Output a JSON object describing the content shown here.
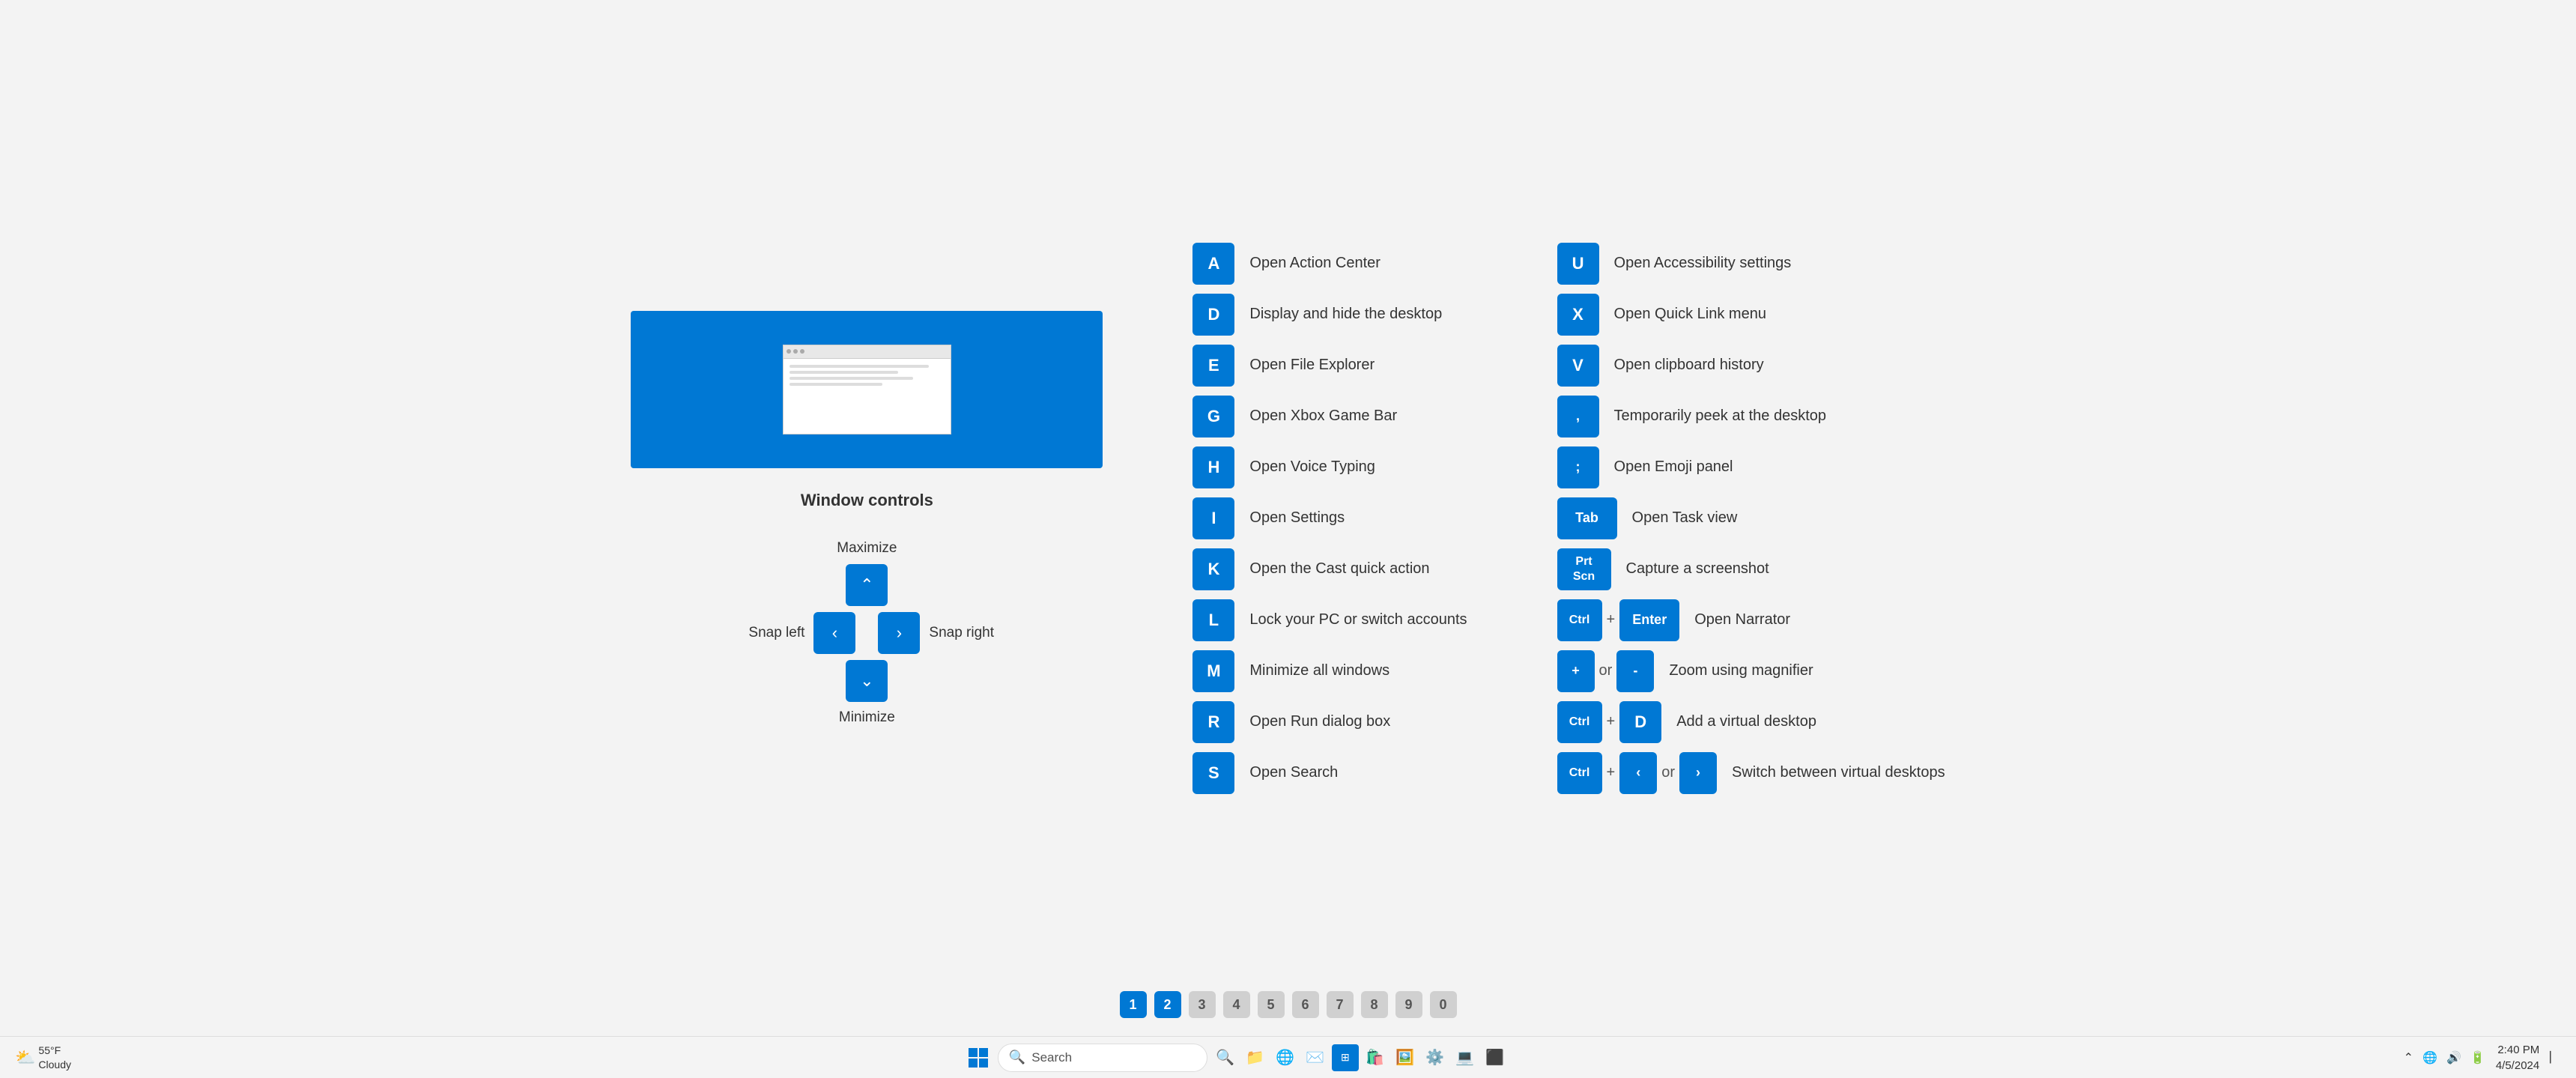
{
  "left_panel": {
    "window_controls_label": "Window controls",
    "controls": {
      "maximize_label": "Maximize",
      "snap_left_label": "Snap left",
      "snap_right_label": "Snap right",
      "minimize_label": "Minimize",
      "up_arrow": "^",
      "left_arrow": "<",
      "right_arrow": ">",
      "down_arrow": "v"
    }
  },
  "shortcuts_left": [
    {
      "key": "A",
      "desc": "Open Action Center"
    },
    {
      "key": "D",
      "desc": "Display and hide the desktop"
    },
    {
      "key": "E",
      "desc": "Open File Explorer"
    },
    {
      "key": "G",
      "desc": "Open Xbox Game Bar"
    },
    {
      "key": "H",
      "desc": "Open Voice Typing"
    },
    {
      "key": "I",
      "desc": "Open Settings"
    },
    {
      "key": "K",
      "desc": "Open the Cast quick action"
    },
    {
      "key": "L",
      "desc": "Lock your PC or switch accounts"
    },
    {
      "key": "M",
      "desc": "Minimize all windows"
    },
    {
      "key": "R",
      "desc": "Open Run dialog box"
    },
    {
      "key": "S",
      "desc": "Open Search"
    }
  ],
  "shortcuts_right": [
    {
      "key": "U",
      "desc": "Open Accessibility settings",
      "type": "single"
    },
    {
      "key": "X",
      "desc": "Open Quick Link menu",
      "type": "single"
    },
    {
      "key": "V",
      "desc": "Open clipboard history",
      "type": "single"
    },
    {
      "key": ",",
      "desc": "Temporarily peek at the desktop",
      "type": "single"
    },
    {
      "key": ";",
      "desc": "Open Emoji panel",
      "type": "single"
    },
    {
      "key": "Tab",
      "desc": "Open Task view",
      "type": "wide"
    },
    {
      "key_main": "Prt\nScn",
      "desc": "Capture a screenshot",
      "type": "prtscn"
    },
    {
      "combo": [
        "Ctrl",
        "+",
        "Enter"
      ],
      "desc": "Open Narrator",
      "type": "combo"
    },
    {
      "combo": [
        "+",
        "or",
        "-"
      ],
      "desc": "Zoom using magnifier",
      "type": "combo2"
    },
    {
      "combo": [
        "Ctrl",
        "+",
        "D"
      ],
      "desc": "Add a virtual desktop",
      "type": "combo3"
    },
    {
      "combo": [
        "Ctrl",
        "+",
        "<",
        "or",
        ">"
      ],
      "desc": "Switch between virtual desktops",
      "type": "combo4"
    }
  ],
  "page_dots": [
    "1",
    "2",
    "3",
    "4",
    "5",
    "6",
    "7",
    "8",
    "9",
    "0"
  ],
  "active_dot": 2,
  "taskbar": {
    "weather": "55°F\nCloudy",
    "search_placeholder": "Search",
    "clock_time": "2:40 PM",
    "clock_date": "4/5/2024"
  }
}
